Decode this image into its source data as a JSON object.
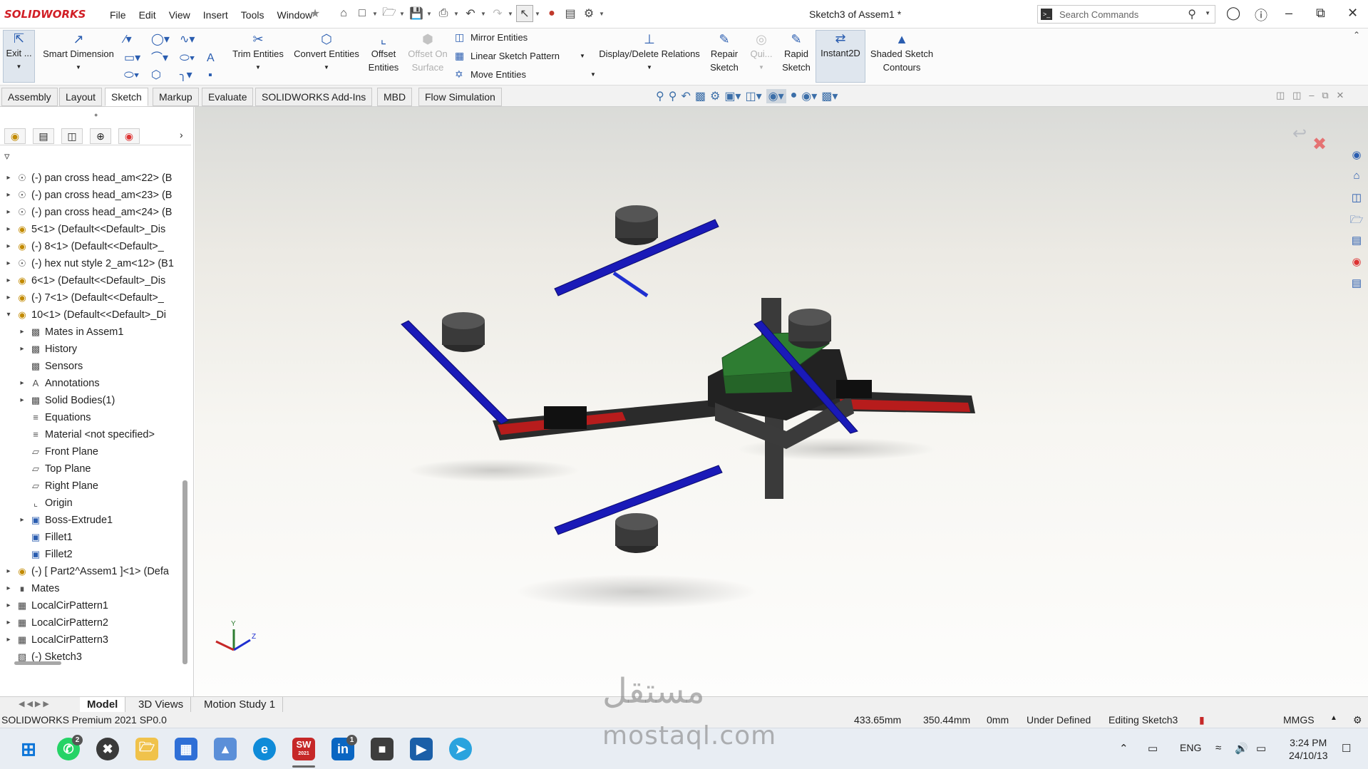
{
  "app": {
    "brand": "SOLIDWORKS",
    "doc_title": "Sketch3 of Assem1 *"
  },
  "menu": [
    "File",
    "Edit",
    "View",
    "Insert",
    "Tools",
    "Window"
  ],
  "search": {
    "placeholder": "Search Commands"
  },
  "ribbon": {
    "exit": "Exit ...",
    "smart_dimension": "Smart Dimension",
    "trim": "Trim Entities",
    "convert": "Convert Entities",
    "offset_1": "Offset",
    "offset_2": "Entities",
    "offset_surface_1": "Offset On",
    "offset_surface_2": "Surface",
    "mirror": "Mirror Entities",
    "linear_pattern": "Linear Sketch Pattern",
    "move": "Move Entities",
    "display_relations": "Display/Delete Relations",
    "repair_1": "Repair",
    "repair_2": "Sketch",
    "quick": "Qui...",
    "rapid_1": "Rapid",
    "rapid_2": "Sketch",
    "instant2d": "Instant2D",
    "shaded_1": "Shaded Sketch",
    "shaded_2": "Contours"
  },
  "tabs": [
    "Assembly",
    "Layout",
    "Sketch",
    "Markup",
    "Evaluate",
    "SOLIDWORKS Add-Ins",
    "MBD",
    "Flow Simulation"
  ],
  "tree": [
    {
      "label": "(-) pan cross head_am<22> (B",
      "icon": "screw-icon",
      "arrow": "right",
      "indent": 0
    },
    {
      "label": "(-) pan cross head_am<23> (B",
      "icon": "screw-icon",
      "arrow": "right",
      "indent": 0
    },
    {
      "label": "(-) pan cross head_am<24> (B",
      "icon": "screw-icon",
      "arrow": "right",
      "indent": 0
    },
    {
      "label": "5<1> (Default<<Default>_Dis",
      "icon": "part-icon",
      "arrow": "right",
      "indent": 0
    },
    {
      "label": "(-) 8<1> (Default<<Default>_",
      "icon": "part-icon",
      "arrow": "right",
      "indent": 0
    },
    {
      "label": "(-) hex nut style 2_am<12> (B1",
      "icon": "screw-icon",
      "arrow": "right",
      "indent": 0
    },
    {
      "label": "6<1> (Default<<Default>_Dis",
      "icon": "part-icon",
      "arrow": "right",
      "indent": 0
    },
    {
      "label": "(-) 7<1> (Default<<Default>_",
      "icon": "part-icon",
      "arrow": "right",
      "indent": 0
    },
    {
      "label": "10<1> (Default<<Default>_Di",
      "icon": "part-icon",
      "arrow": "down",
      "indent": 0
    },
    {
      "label": "Mates in Assem1",
      "icon": "mates-folder-icon",
      "arrow": "right",
      "indent": 1
    },
    {
      "label": "History",
      "icon": "history-icon",
      "arrow": "right",
      "indent": 1
    },
    {
      "label": "Sensors",
      "icon": "sensors-icon",
      "arrow": "none",
      "indent": 1
    },
    {
      "label": "Annotations",
      "icon": "annotations-icon",
      "arrow": "right",
      "indent": 1
    },
    {
      "label": "Solid Bodies(1)",
      "icon": "solid-bodies-icon",
      "arrow": "right",
      "indent": 1
    },
    {
      "label": "Equations",
      "icon": "equations-icon",
      "arrow": "none",
      "indent": 1
    },
    {
      "label": "Material <not specified>",
      "icon": "material-icon",
      "arrow": "none",
      "indent": 1
    },
    {
      "label": "Front Plane",
      "icon": "plane-icon",
      "arrow": "none",
      "indent": 1
    },
    {
      "label": "Top Plane",
      "icon": "plane-icon",
      "arrow": "none",
      "indent": 1
    },
    {
      "label": "Right Plane",
      "icon": "plane-icon",
      "arrow": "none",
      "indent": 1
    },
    {
      "label": "Origin",
      "icon": "origin-icon",
      "arrow": "none",
      "indent": 1
    },
    {
      "label": "Boss-Extrude1",
      "icon": "extrude-icon",
      "arrow": "right",
      "indent": 1
    },
    {
      "label": "Fillet1",
      "icon": "fillet-icon",
      "arrow": "none",
      "indent": 1
    },
    {
      "label": "Fillet2",
      "icon": "fillet-icon",
      "arrow": "none",
      "indent": 1
    },
    {
      "label": "(-) [ Part2^Assem1 ]<1> (Defa",
      "icon": "part-icon",
      "arrow": "right",
      "indent": 0
    },
    {
      "label": "Mates",
      "icon": "mates-icon",
      "arrow": "right",
      "indent": 0
    },
    {
      "label": "LocalCirPattern1",
      "icon": "pattern-icon",
      "arrow": "right",
      "indent": 0
    },
    {
      "label": "LocalCirPattern2",
      "icon": "pattern-icon",
      "arrow": "right",
      "indent": 0
    },
    {
      "label": "LocalCirPattern3",
      "icon": "pattern-icon",
      "arrow": "right",
      "indent": 0
    },
    {
      "label": "(-) Sketch3",
      "icon": "sketch-icon",
      "arrow": "none",
      "indent": 0
    }
  ],
  "bottom_tabs": [
    "Model",
    "3D Views",
    "Motion Study 1"
  ],
  "status": {
    "product": "SOLIDWORKS Premium 2021 SP0.0",
    "x": "433.65mm",
    "y": "350.44mm",
    "z": "0mm",
    "state": "Under Defined",
    "editing": "Editing Sketch3",
    "units": "MMGS"
  },
  "taskbar": {
    "lang": "ENG",
    "time": "3:24 PM",
    "date": "24/10/13",
    "whatsapp_badge": "2",
    "linkedin_badge": "1",
    "sw_label": "SW",
    "sw_year": "2021"
  },
  "watermark": {
    "arabic": "مستقل",
    "latin": "mostaql.com"
  },
  "triad": {
    "x": "X",
    "y": "Y",
    "z": "Z"
  },
  "colors": {
    "propeller": "#1a1ab8",
    "battery": "#2e7d32",
    "frame": "#2b2b2b",
    "arm": "#b71c1c"
  }
}
